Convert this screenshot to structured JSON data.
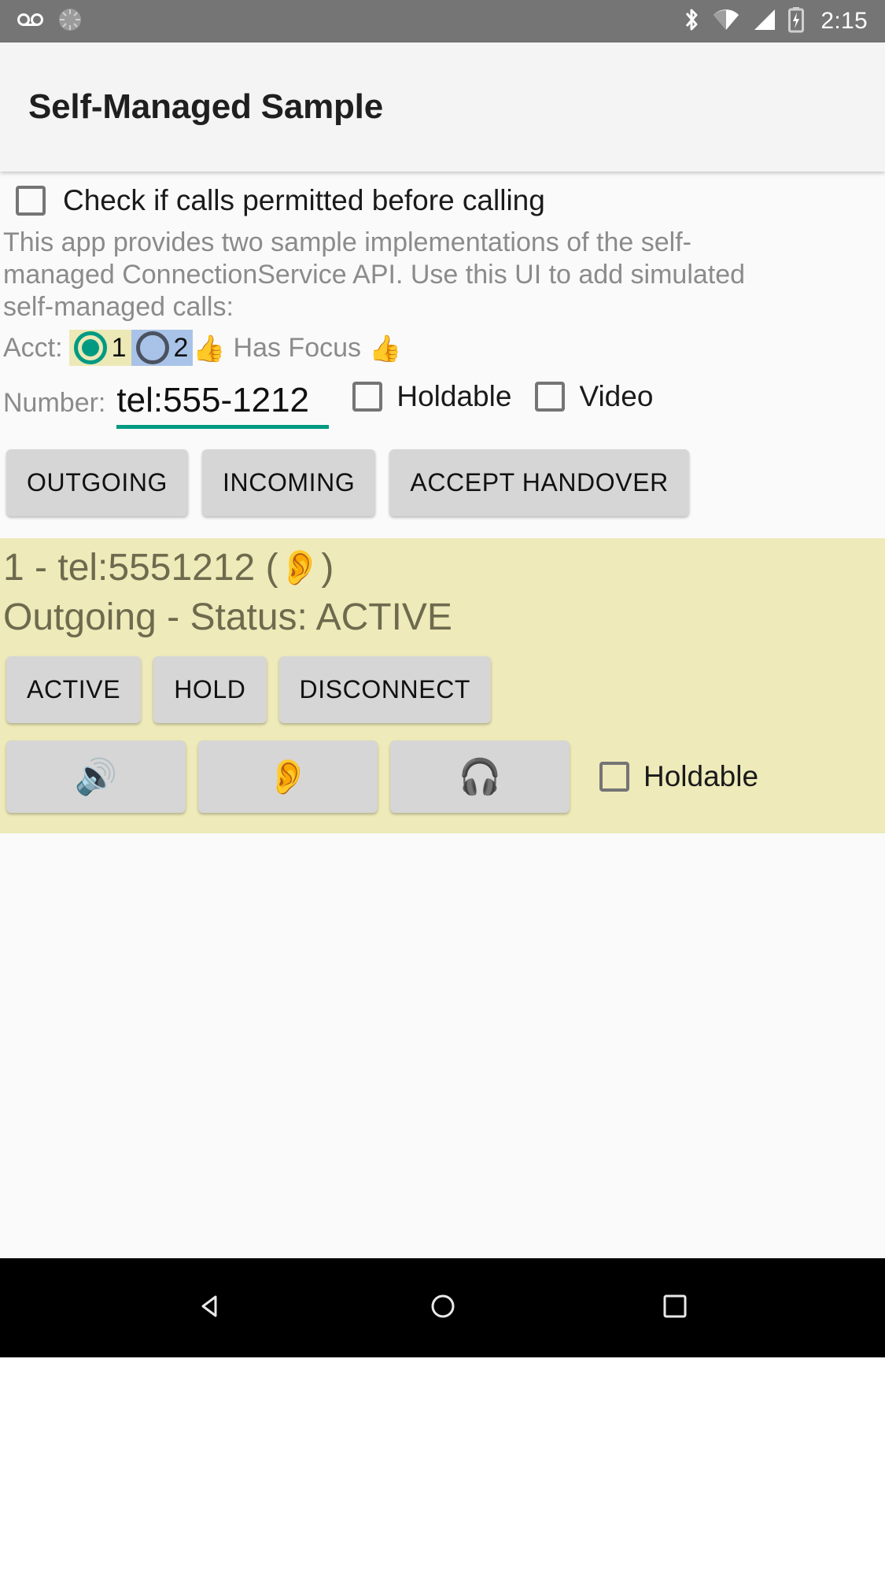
{
  "status_bar": {
    "icons_left": [
      "voicemail-icon",
      "sync-spinner-icon"
    ],
    "icons_right": [
      "bluetooth-icon",
      "wifi-icon",
      "cell-signal-icon",
      "battery-charging-icon"
    ],
    "time": "2:15"
  },
  "app_bar": {
    "title": "Self-Managed Sample"
  },
  "permission_check": {
    "label": "Check if calls permitted before calling",
    "checked": false
  },
  "description": "This app provides two sample implementations of the self-managed ConnectionService API.  Use this UI to add simulated self-managed calls:",
  "account": {
    "label": "Acct:",
    "option_one": "1",
    "option_two": "2",
    "selected": "1",
    "focus_left_emoji": "👍",
    "focus_text": "Has Focus",
    "focus_right_emoji": "👍",
    "chip_one_color": "#ece9b6",
    "chip_two_color": "#a9c3e8",
    "accent_color": "#009a82"
  },
  "number_row": {
    "label": "Number:",
    "value": "tel:555-1212",
    "placeholder": "tel:555-1212",
    "holdable_label": "Holdable",
    "holdable_checked": false,
    "video_label": "Video",
    "video_checked": false
  },
  "action_buttons": [
    {
      "label": "OUTGOING",
      "name": "outgoing-button"
    },
    {
      "label": "INCOMING",
      "name": "incoming-button"
    },
    {
      "label": "ACCEPT HANDOVER",
      "name": "accept-handover-button"
    }
  ],
  "call_card": {
    "background_color": "#eeeab9",
    "title_prefix": "1 - tel:5551212 ( ",
    "title_route_emoji": "👂",
    "title_suffix": " )",
    "status": "Outgoing - Status: ACTIVE",
    "state_buttons": [
      {
        "label": "ACTIVE",
        "name": "call-active-button"
      },
      {
        "label": "HOLD",
        "name": "call-hold-button"
      },
      {
        "label": "DISCONNECT",
        "name": "call-disconnect-button"
      }
    ],
    "audio_buttons": [
      {
        "emoji": "🔊",
        "name": "audio-route-speaker-button"
      },
      {
        "emoji": "👂",
        "name": "audio-route-earpiece-button"
      },
      {
        "emoji": "🎧",
        "name": "audio-route-headset-button"
      }
    ],
    "holdable_label": "Holdable",
    "holdable_checked": false
  },
  "nav_bar": {
    "back": "back-nav-button",
    "home": "home-nav-button",
    "recents": "recents-nav-button"
  }
}
